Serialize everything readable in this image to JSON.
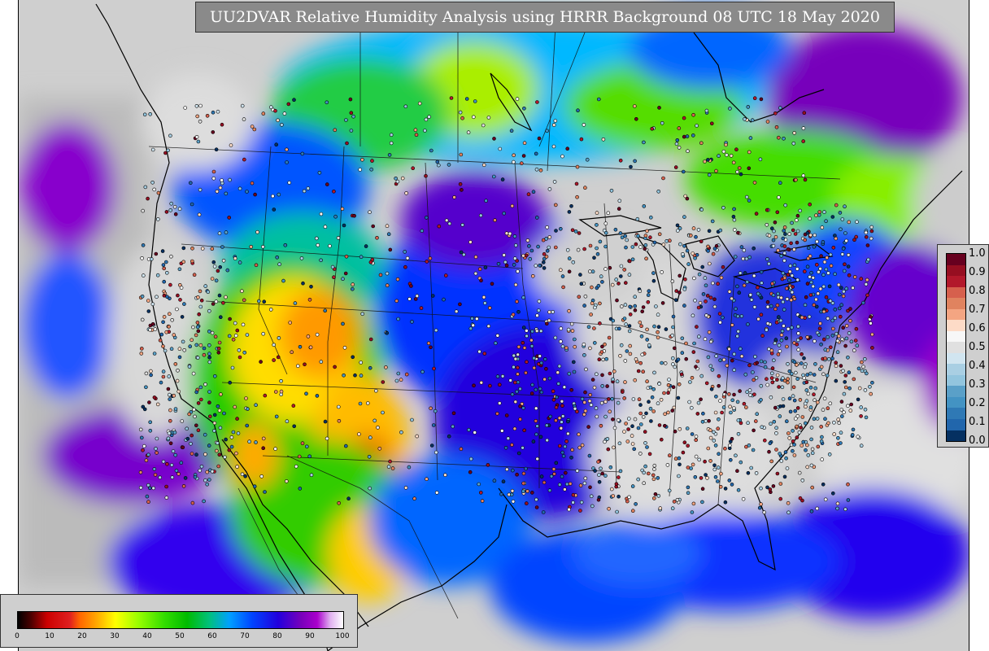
{
  "title": "UU2DVAR Relative Humidity Analysis using HRRR Background 08 UTC 18 May 2020",
  "observation_legend": {
    "ticks": [
      "1.0",
      "0.9",
      "0.8",
      "0.7",
      "0.6",
      "0.5",
      "0.4",
      "0.3",
      "0.2",
      "0.1",
      "0.0"
    ],
    "colors_top_to_bottom": [
      "#67001f",
      "#960e21",
      "#b2182b",
      "#d6604d",
      "#e0835f",
      "#f4a582",
      "#fddbc7",
      "#f7f7f7",
      "#e0e0e0",
      "#d1e5f0",
      "#a9cfe3",
      "#92c5de",
      "#5aa0c8",
      "#4393c3",
      "#2f79b5",
      "#2166ac",
      "#053061"
    ]
  },
  "rh_colorbar": {
    "ticks": [
      "0",
      "10",
      "20",
      "30",
      "40",
      "50",
      "60",
      "70",
      "80",
      "90",
      "100"
    ],
    "stops": [
      {
        "v": 0,
        "c": "#000000"
      },
      {
        "v": 4,
        "c": "#4a0000"
      },
      {
        "v": 9,
        "c": "#cc0000"
      },
      {
        "v": 16,
        "c": "#e02020"
      },
      {
        "v": 19,
        "c": "#ff6600"
      },
      {
        "v": 24,
        "c": "#ffa500"
      },
      {
        "v": 30,
        "c": "#ffff00"
      },
      {
        "v": 37,
        "c": "#99ff00"
      },
      {
        "v": 45,
        "c": "#33dd00"
      },
      {
        "v": 52,
        "c": "#00bb00"
      },
      {
        "v": 59,
        "c": "#00c080"
      },
      {
        "v": 65,
        "c": "#00a0ff"
      },
      {
        "v": 72,
        "c": "#0044ff"
      },
      {
        "v": 80,
        "c": "#2200dd"
      },
      {
        "v": 87,
        "c": "#7700bb"
      },
      {
        "v": 92,
        "c": "#aa00cc"
      },
      {
        "v": 96,
        "c": "#e0b0f0"
      },
      {
        "v": 100,
        "c": "#ffffff"
      }
    ]
  },
  "colors": {
    "land_ocean_gray": "#cccccc",
    "title_bg": "#8a8a8a",
    "title_text": "#ffffff",
    "legend_bg": "#cfcfcf"
  }
}
